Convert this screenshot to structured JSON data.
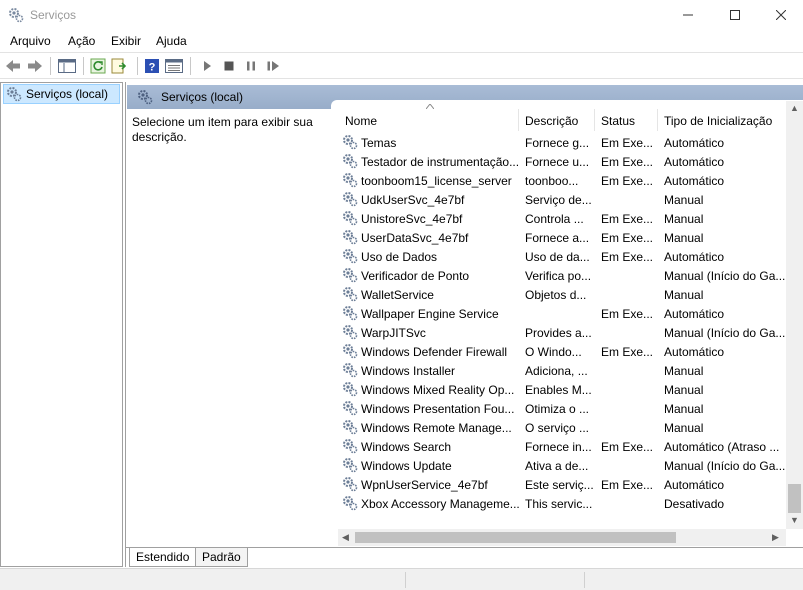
{
  "window": {
    "title": "Serviços"
  },
  "menu": [
    "Arquivo",
    "Ação",
    "Exibir",
    "Ajuda"
  ],
  "tree": {
    "root_label": "Serviços (local)"
  },
  "pane": {
    "header": "Serviços (local)",
    "description": "Selecione um item para exibir sua descrição."
  },
  "columns": [
    "Nome",
    "Descrição",
    "Status",
    "Tipo de Inicialização"
  ],
  "rows": [
    {
      "name": "Temas",
      "desc": "Fornece g...",
      "status": "Em Exe...",
      "start": "Automático"
    },
    {
      "name": "Testador de instrumentação...",
      "desc": "Fornece u...",
      "status": "Em Exe...",
      "start": "Automático"
    },
    {
      "name": "toonboom15_license_server",
      "desc": "toonboo...",
      "status": "Em Exe...",
      "start": "Automático"
    },
    {
      "name": "UdkUserSvc_4e7bf",
      "desc": "Serviço de...",
      "status": "",
      "start": "Manual"
    },
    {
      "name": "UnistoreSvc_4e7bf",
      "desc": "Controla ...",
      "status": "Em Exe...",
      "start": "Manual"
    },
    {
      "name": "UserDataSvc_4e7bf",
      "desc": "Fornece a...",
      "status": "Em Exe...",
      "start": "Manual"
    },
    {
      "name": "Uso de Dados",
      "desc": "Uso de da...",
      "status": "Em Exe...",
      "start": "Automático"
    },
    {
      "name": "Verificador de Ponto",
      "desc": "Verifica po...",
      "status": "",
      "start": "Manual (Início do Ga..."
    },
    {
      "name": "WalletService",
      "desc": "Objetos d...",
      "status": "",
      "start": "Manual"
    },
    {
      "name": "Wallpaper Engine Service",
      "desc": "",
      "status": "Em Exe...",
      "start": "Automático"
    },
    {
      "name": "WarpJITSvc",
      "desc": "Provides a...",
      "status": "",
      "start": "Manual (Início do Ga..."
    },
    {
      "name": "Windows Defender Firewall",
      "desc": "O Windo...",
      "status": "Em Exe...",
      "start": "Automático"
    },
    {
      "name": "Windows Installer",
      "desc": "Adiciona, ...",
      "status": "",
      "start": "Manual"
    },
    {
      "name": "Windows Mixed Reality Op...",
      "desc": "Enables M...",
      "status": "",
      "start": "Manual"
    },
    {
      "name": "Windows Presentation Fou...",
      "desc": "Otimiza o ...",
      "status": "",
      "start": "Manual"
    },
    {
      "name": "Windows Remote Manage...",
      "desc": "O serviço ...",
      "status": "",
      "start": "Manual"
    },
    {
      "name": "Windows Search",
      "desc": "Fornece in...",
      "status": "Em Exe...",
      "start": "Automático (Atraso ..."
    },
    {
      "name": "Windows Update",
      "desc": "Ativa a de...",
      "status": "",
      "start": "Manual (Início do Ga..."
    },
    {
      "name": "WpnUserService_4e7bf",
      "desc": "Este serviç...",
      "status": "Em Exe...",
      "start": "Automático"
    },
    {
      "name": "Xbox Accessory Manageme...",
      "desc": "This servic...",
      "status": "",
      "start": "Desativado"
    }
  ],
  "tabs": [
    "Estendido",
    "Padrão"
  ],
  "icons": {
    "service": "gear-icon",
    "toolbar": [
      "back-arrow-icon",
      "forward-arrow-icon",
      "console-tree-icon",
      "refresh-icon",
      "export-list-icon",
      "help-icon",
      "properties-icon",
      "play-icon",
      "stop-icon",
      "pause-icon",
      "restart-icon"
    ]
  },
  "colors": {
    "pane_header": "#a9bcd6",
    "selection": "#cce8ff",
    "help_blue": "#2b4fb3"
  }
}
